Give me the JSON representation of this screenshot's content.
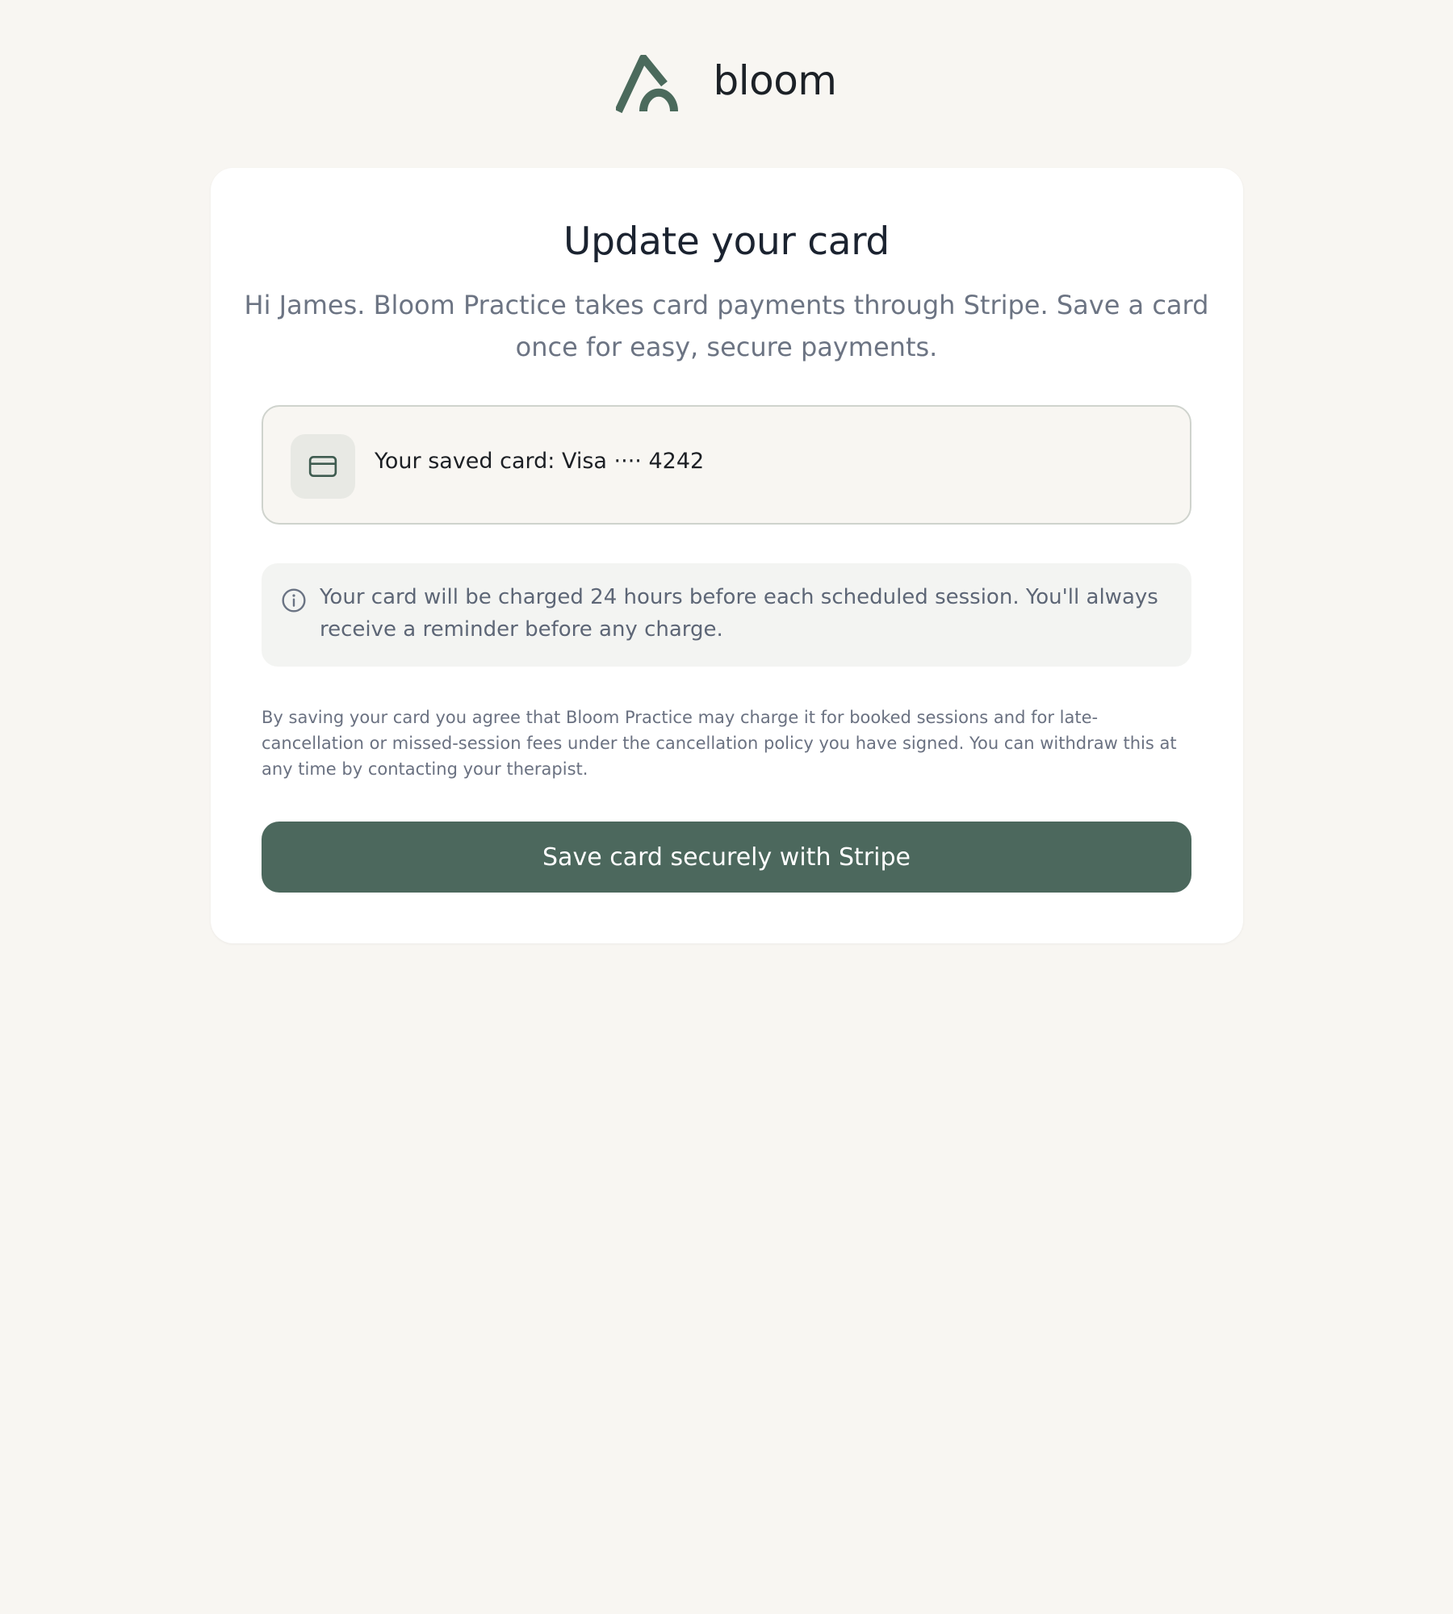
{
  "brand": {
    "name": "bloom",
    "logo_icon": "bloom-logo-icon",
    "color": "#4b6a5c"
  },
  "page": {
    "title": "Update your card",
    "subtitle": "Hi James. Bloom Practice takes card payments through Stripe. Save a card once for easy, secure payments."
  },
  "saved_card": {
    "icon": "credit-card-icon",
    "label": "Your saved card: Visa ···· 4242"
  },
  "notice": {
    "icon": "info-icon",
    "text": "Your card will be charged 24 hours before each scheduled session. You'll always receive a reminder before any charge."
  },
  "legal": {
    "text": "By saving your card you agree that Bloom Practice may charge it for booked sessions and for late-cancellation or missed-session fees under the cancellation policy you have signed. You can withdraw this at any time by contacting your therapist."
  },
  "actions": {
    "save_label": "Save card securely with Stripe",
    "button_color": "#4c685d"
  }
}
